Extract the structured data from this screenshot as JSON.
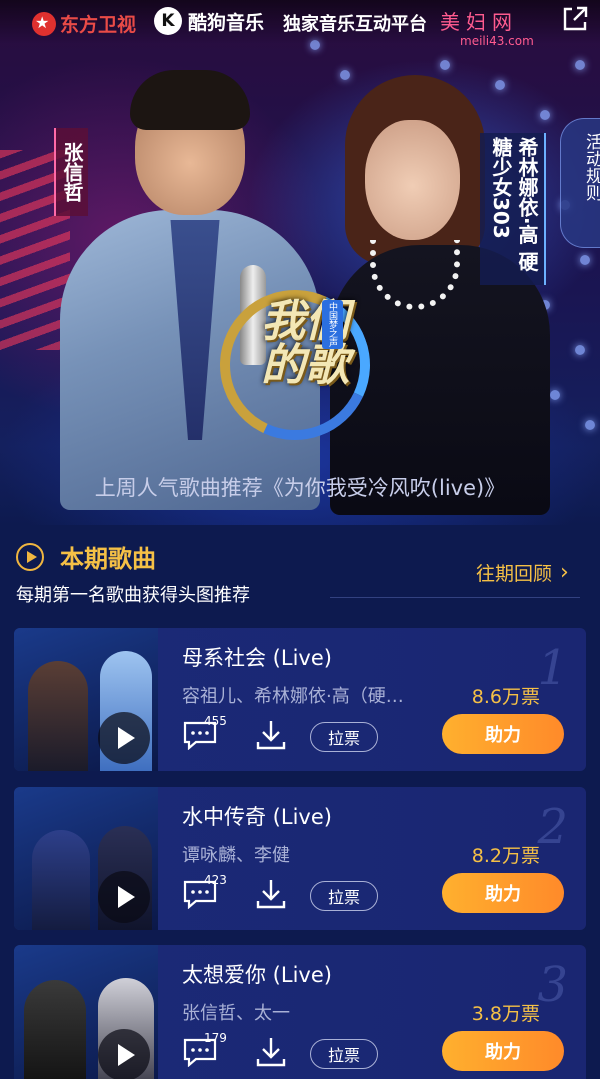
{
  "topbar": {
    "channel_logo_text": "东方卫视",
    "app_logo_letter": "K",
    "app_name": "酷狗音乐",
    "tagline": "独家音乐互动平台",
    "watermark": "美妇网",
    "watermark_url": "meili43.com",
    "share_icon": "share-external-icon"
  },
  "hero": {
    "performer_left_name": "张信哲",
    "performer_right_name": "希林娜依·高 硬糖少女303",
    "rules_tab": "活动规则",
    "show_logo_text": "我们的歌",
    "show_logo_badge": "中国梦之声",
    "recommend_text": "上周人气歌曲推荐《为你我受冷风吹(live)》"
  },
  "section": {
    "title": "本期歌曲",
    "subtitle": "每期第一名歌曲获得头图推荐",
    "history_link": "往期回顾",
    "icon": "play-circle-icon",
    "accent_color": "#f5c046"
  },
  "songs": [
    {
      "rank": "1",
      "title": "母系社会 (Live)",
      "artists": "容祖儿、希林娜依·高（硬…",
      "votes": "8.6万票",
      "comments": "455",
      "vote_label": "拉票",
      "assist_label": "助力"
    },
    {
      "rank": "2",
      "title": "水中传奇 (Live)",
      "artists": "谭咏麟、李健",
      "votes": "8.2万票",
      "comments": "423",
      "vote_label": "拉票",
      "assist_label": "助力"
    },
    {
      "rank": "3",
      "title": "太想爱你 (Live)",
      "artists": "张信哲、太一",
      "votes": "3.8万票",
      "comments": "179",
      "vote_label": "拉票",
      "assist_label": "助力"
    }
  ],
  "colors": {
    "background": "#0d1a4f",
    "card": "#1b2a77",
    "gold": "#f5c046",
    "assist_button": "#ff9a2c"
  }
}
